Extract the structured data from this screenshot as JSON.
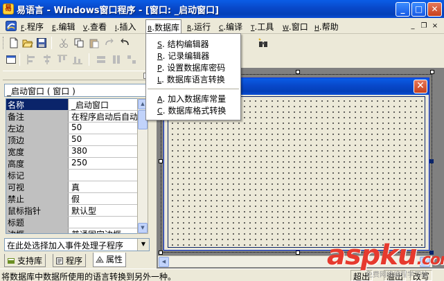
{
  "titlebar": {
    "title": "易语言 - Windows窗口程序 - [窗口: _启动窗口]",
    "minimize": "_",
    "maximize": "□",
    "close": "✕"
  },
  "menubar": {
    "items": [
      {
        "key": "F",
        "label": ".程序"
      },
      {
        "key": "E",
        "label": ".编辑"
      },
      {
        "key": "V",
        "label": ".查看"
      },
      {
        "key": "I",
        "label": ".插入"
      },
      {
        "key": "B",
        "label": ".数据库"
      },
      {
        "key": "R",
        "label": ".运行"
      },
      {
        "key": "C",
        "label": ".编译"
      },
      {
        "key": "T",
        "label": ".工具"
      },
      {
        "key": "W",
        "label": ".窗口"
      },
      {
        "key": "H",
        "label": ".帮助"
      }
    ],
    "mdi_min": "_",
    "mdi_restore": "❐",
    "mdi_close": "×"
  },
  "dropdown": {
    "items": [
      {
        "key": "S",
        "label": ". 结构编辑器"
      },
      {
        "key": "R",
        "label": ". 记录编辑器"
      },
      {
        "key": "P",
        "label": ". 设置数据库密码"
      },
      {
        "key": "L",
        "label": ". 数据库语言转换"
      },
      {
        "key": "A",
        "label": ". 加入数据库常量"
      },
      {
        "key": "C",
        "label": ". 数据库格式转换"
      }
    ]
  },
  "leftpanel": {
    "object_combo": "_启动窗口 ( 窗口 )",
    "properties": [
      {
        "name": "名称",
        "value": "_启动窗口"
      },
      {
        "name": "备注",
        "value": "在程序启动后自动"
      },
      {
        "name": "左边",
        "value": "50"
      },
      {
        "name": "顶边",
        "value": "50"
      },
      {
        "name": "宽度",
        "value": "380"
      },
      {
        "name": "高度",
        "value": "250"
      },
      {
        "name": "标记",
        "value": ""
      },
      {
        "name": "可视",
        "value": "真"
      },
      {
        "name": "禁止",
        "value": "假"
      },
      {
        "name": "鼠标指针",
        "value": "默认型"
      },
      {
        "name": "标题",
        "value": ""
      },
      {
        "name": "边框",
        "value": "普通固定边框"
      }
    ],
    "event_combo": "在此处选择加入事件处理子程序",
    "tabs": [
      "支持库",
      "程序",
      "属性"
    ]
  },
  "statusbar": {
    "text": "将数据库中数据所使用的语言转换到另外一种。",
    "cells": [
      "超出",
      "溢出",
      "改写"
    ]
  },
  "watermark": {
    "brand": "aspku",
    "suffix": ".com",
    "sub": "免费网络编程学习站"
  }
}
